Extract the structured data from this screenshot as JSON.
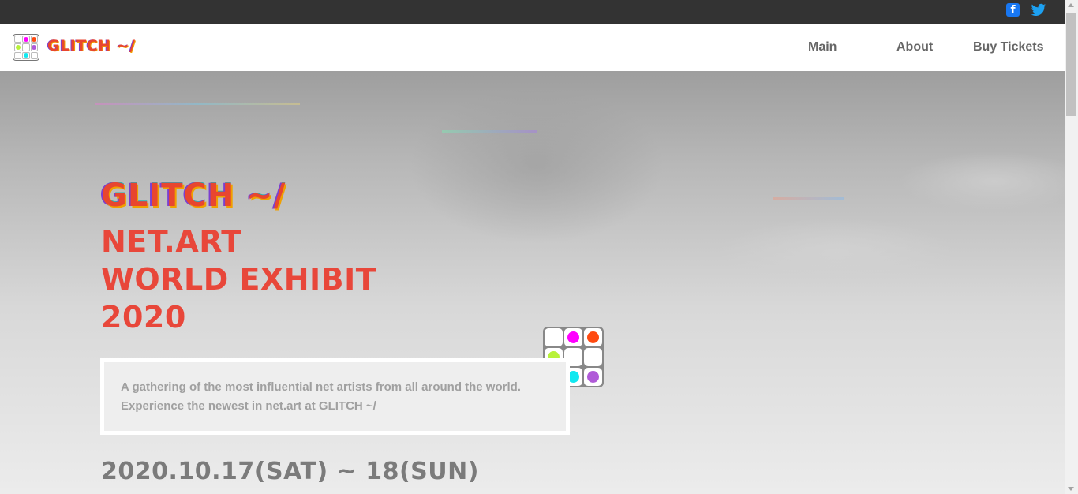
{
  "topbar": {
    "social": [
      {
        "icon": "facebook-icon",
        "glyph": "f",
        "color": "#1877f2"
      },
      {
        "icon": "twitter-icon",
        "color": "#1da1f2"
      }
    ]
  },
  "nav": {
    "logo_text": "GLITCH ~/",
    "links": [
      {
        "label": "Main"
      },
      {
        "label": "About"
      },
      {
        "label": "Buy Tickets"
      }
    ]
  },
  "hero": {
    "logo_text": "GLITCH ~/",
    "title_lines": [
      "NET.ART",
      "WORLD EXHIBIT",
      "2020"
    ],
    "description_lines": [
      "A gathering of the most influential net artists from all around the world.",
      "Experience the newest in net.art at GLITCH ~/"
    ],
    "date": "2020.10.17(SAT) ~ 18(SUN)"
  },
  "colors": {
    "accent": "#e8473a",
    "topbar": "#333333",
    "nav_text": "#666666",
    "date_text": "#7b7b7b",
    "dot_magenta": "#ff00ff",
    "dot_orange": "#ff4a10",
    "dot_lime": "#b8f23a",
    "dot_cyan": "#11e8f0",
    "dot_purple": "#b05ad8"
  }
}
